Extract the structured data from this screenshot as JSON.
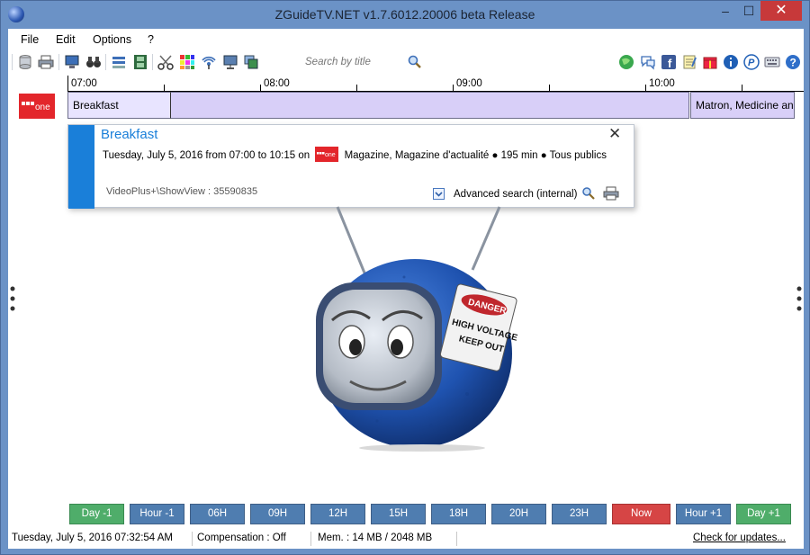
{
  "window": {
    "title": "ZGuideTV.NET v1.7.6012.20006 beta Release",
    "minimize_glyph": "–",
    "maximize_glyph": "☐",
    "close_glyph": "✕"
  },
  "menu": {
    "items": [
      "File",
      "Edit",
      "Options",
      "?"
    ]
  },
  "toolbar": {
    "search_placeholder": "Search by title",
    "left_icons": [
      "database-icon",
      "print-icon",
      "monitor-icon",
      "binoculars-icon",
      "stack-icon",
      "film-icon",
      "scissors-icon",
      "color-grid-icon",
      "broadcast-icon",
      "screen-icon",
      "windows-icon"
    ],
    "right_icons": [
      "globe-icon",
      "chat-icon",
      "facebook-icon",
      "notepad-icon",
      "gift-icon",
      "info-icon",
      "paypal-icon",
      "keyboard-icon",
      "help-icon"
    ]
  },
  "timeline": {
    "ticks": [
      "07:00",
      "08:00",
      "09:00",
      "10:00"
    ]
  },
  "channel": {
    "logo_text": "BBC one",
    "programs": [
      {
        "title": "Breakfast"
      },
      {
        "title": ""
      },
      {
        "title": "Matron, Medicine and"
      }
    ]
  },
  "popup": {
    "title": "Breakfast",
    "close_glyph": "✕",
    "line_prefix": "Tuesday, July 5, 2016 from 07:00 to 10:15 on",
    "line_suffix": "Magazine, Magazine d'actualité ● 195 min ● Tous publics",
    "videoplus": "VideoPlus+\\ShowView : 35590835",
    "advanced_search": "Advanced search (internal)"
  },
  "mascot": {
    "sign_line1": "DANGER",
    "sign_line2": "HIGH VOLTAGE",
    "sign_line3": "KEEP OUT"
  },
  "nav_buttons": [
    {
      "label": "Day -1",
      "color": "#4fad6a"
    },
    {
      "label": "Hour -1",
      "color": "#4f7db0"
    },
    {
      "label": "06H",
      "color": "#4f7db0"
    },
    {
      "label": "09H",
      "color": "#4f7db0"
    },
    {
      "label": "12H",
      "color": "#4f7db0"
    },
    {
      "label": "15H",
      "color": "#4f7db0"
    },
    {
      "label": "18H",
      "color": "#4f7db0"
    },
    {
      "label": "20H",
      "color": "#4f7db0"
    },
    {
      "label": "23H",
      "color": "#4f7db0"
    },
    {
      "label": "Now",
      "color": "#d64545"
    },
    {
      "label": "Hour +1",
      "color": "#4f7db0"
    },
    {
      "label": "Day +1",
      "color": "#4fad6a"
    }
  ],
  "status": {
    "datetime": "Tuesday, July 5, 2016  07:32:54 AM",
    "compensation": "Compensation :   Off",
    "memory": "Mem. :  14 MB / 2048 MB",
    "updates_link": "Check for updates..."
  }
}
